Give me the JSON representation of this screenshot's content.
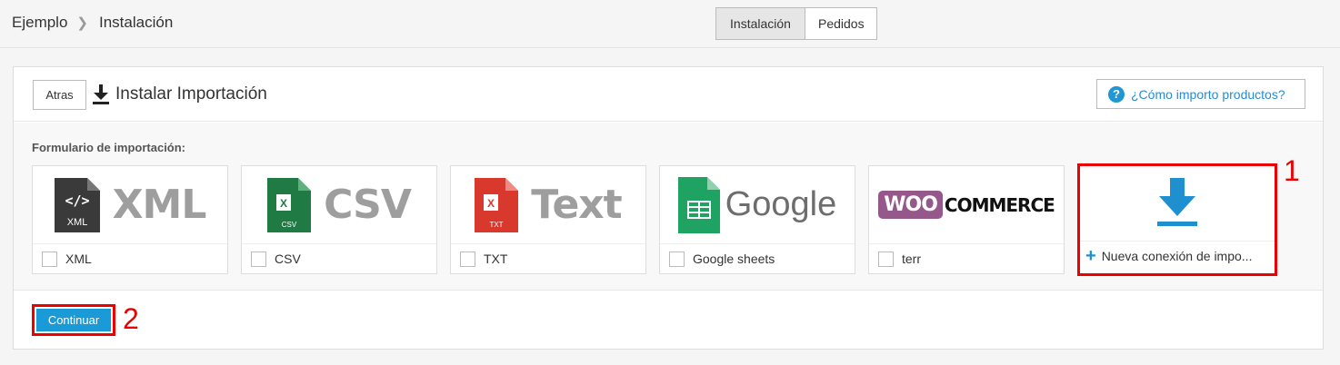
{
  "breadcrumb": {
    "root": "Ejemplo",
    "current": "Instalación"
  },
  "tabs": [
    {
      "label": "Instalación"
    },
    {
      "label": "Pedidos"
    }
  ],
  "panel": {
    "back_label": "Atras",
    "title": "Instalar Importación",
    "help_label": "¿Cómo importo productos?",
    "form_label": "Formulario de importación:",
    "cards": [
      {
        "logo_text": "XML",
        "logo_sub": "XML",
        "label": "XML"
      },
      {
        "logo_text": "CSV",
        "logo_sub": "CSV",
        "label": "CSV"
      },
      {
        "logo_text": "Text",
        "logo_sub": "TXT",
        "label": "TXT"
      },
      {
        "logo_text": "Google",
        "label": "Google sheets"
      },
      {
        "logo_text_1": "WOO",
        "logo_text_2": "COMMERCE",
        "label": "terr"
      }
    ],
    "new_connection_label": "Nueva conexión de impo...",
    "continue_label": "Continuar"
  },
  "annotations": {
    "one": "1",
    "two": "2"
  },
  "colors": {
    "accent": "#1a9ad6",
    "highlight": "#ee0000",
    "woo": "#96588a"
  }
}
